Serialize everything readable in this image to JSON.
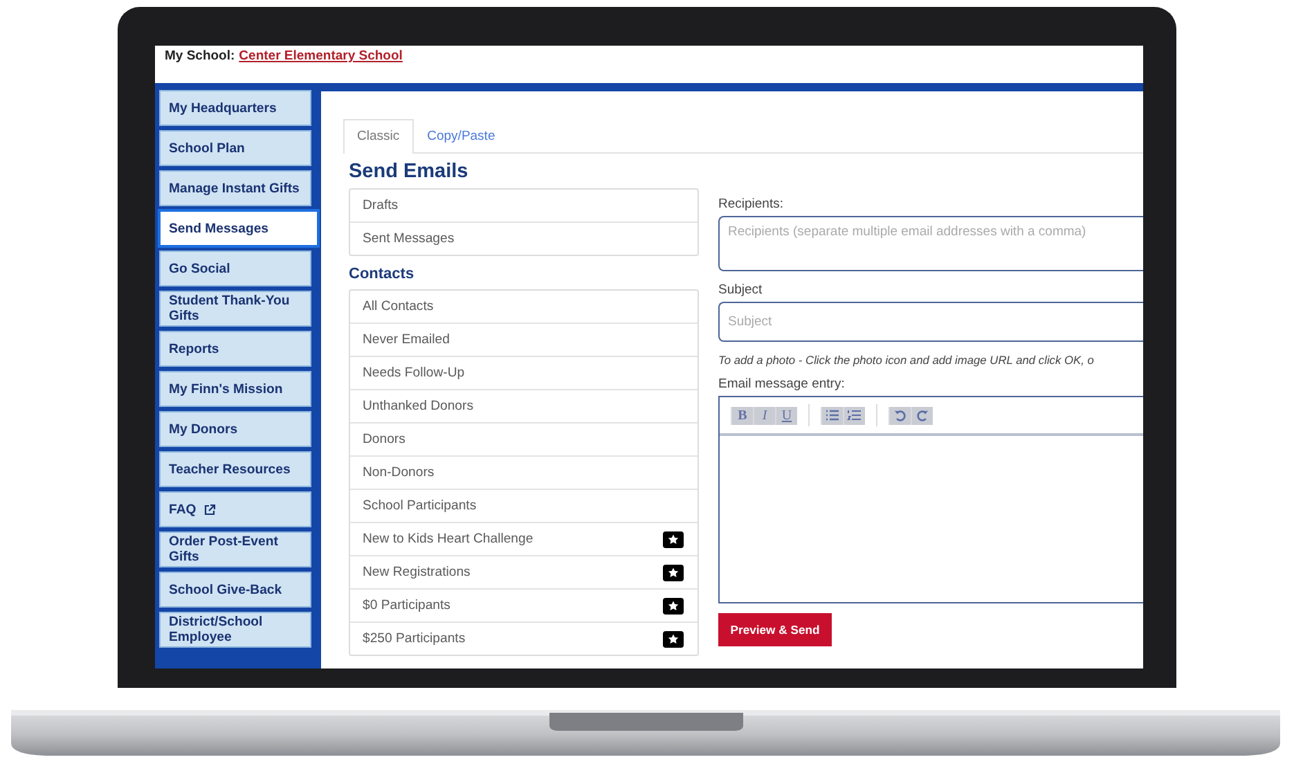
{
  "header": {
    "label": "My School:",
    "school_link": "Center Elementary School"
  },
  "sidebar": {
    "items": [
      {
        "label": "My Headquarters",
        "selected": false,
        "external": false
      },
      {
        "label": "School Plan",
        "selected": false,
        "external": false
      },
      {
        "label": "Manage Instant Gifts",
        "selected": false,
        "external": false
      },
      {
        "label": "Send Messages",
        "selected": true,
        "external": false
      },
      {
        "label": "Go Social",
        "selected": false,
        "external": false
      },
      {
        "label": "Student Thank-You Gifts",
        "selected": false,
        "external": false
      },
      {
        "label": "Reports",
        "selected": false,
        "external": false
      },
      {
        "label": "My Finn's Mission",
        "selected": false,
        "external": false
      },
      {
        "label": "My Donors",
        "selected": false,
        "external": false
      },
      {
        "label": "Teacher Resources",
        "selected": false,
        "external": false
      },
      {
        "label": "FAQ",
        "selected": false,
        "external": true
      },
      {
        "label": "Order Post-Event Gifts",
        "selected": false,
        "external": false
      },
      {
        "label": "School Give-Back",
        "selected": false,
        "external": false
      },
      {
        "label": "District/School Employee",
        "selected": false,
        "external": false
      }
    ]
  },
  "tabs": [
    {
      "label": "Classic",
      "selected": true
    },
    {
      "label": "Copy/Paste",
      "selected": false
    }
  ],
  "title": "Send Emails",
  "message_folders": [
    {
      "label": "Drafts"
    },
    {
      "label": "Sent Messages"
    }
  ],
  "contacts": {
    "heading": "Contacts",
    "items": [
      {
        "label": "All Contacts",
        "starred": false
      },
      {
        "label": "Never Emailed",
        "starred": false
      },
      {
        "label": "Needs Follow-Up",
        "starred": false
      },
      {
        "label": "Unthanked Donors",
        "starred": false
      },
      {
        "label": "Donors",
        "starred": false
      },
      {
        "label": "Non-Donors",
        "starred": false
      },
      {
        "label": "School Participants",
        "starred": false
      },
      {
        "label": "New to Kids Heart Challenge",
        "starred": true
      },
      {
        "label": "New Registrations",
        "starred": true
      },
      {
        "label": "$0 Participants",
        "starred": true
      },
      {
        "label": "$250 Participants",
        "starred": true
      }
    ]
  },
  "form": {
    "recipients_label": "Recipients:",
    "recipients_placeholder": "Recipients (separate multiple email addresses with a comma)",
    "subject_label": "Subject",
    "subject_placeholder": "Subject",
    "photo_hint": "To add a photo - Click the photo icon and add image URL and click OK, o",
    "message_label": "Email message entry:",
    "toolbar": [
      {
        "kind": "bold",
        "label": "B"
      },
      {
        "kind": "italic",
        "label": "I"
      },
      {
        "kind": "underline",
        "label": "U"
      },
      {
        "kind": "bullets"
      },
      {
        "kind": "numbers"
      },
      {
        "kind": "undo"
      },
      {
        "kind": "redo"
      }
    ],
    "send_button": "Preview & Send"
  }
}
